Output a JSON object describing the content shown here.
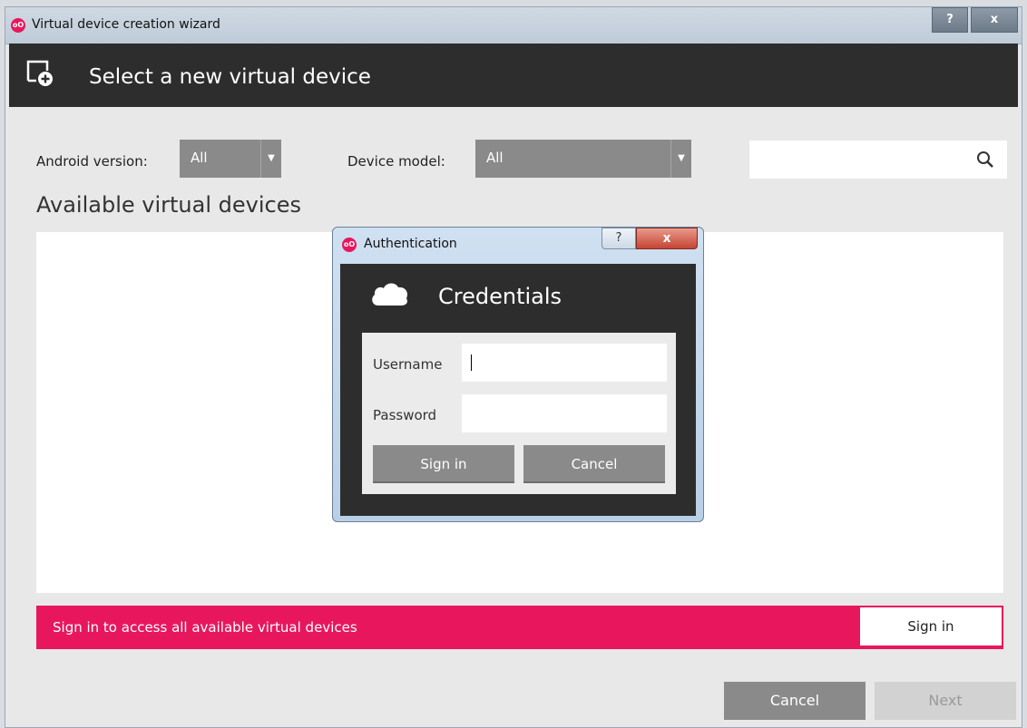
{
  "window": {
    "title": "Virtual device creation wizard",
    "logo_text": "oO",
    "help_label": "?",
    "close_label": "x"
  },
  "header": {
    "title": "Select a new virtual device"
  },
  "filters": {
    "android_label": "Android version:",
    "android_value": "All",
    "device_label": "Device model:",
    "device_value": "All",
    "search_value": ""
  },
  "main": {
    "section_title": "Available virtual devices"
  },
  "banner": {
    "text": "Sign in to access all available virtual devices",
    "button": "Sign in",
    "color": "#e8175d"
  },
  "footer": {
    "cancel": "Cancel",
    "next": "Next"
  },
  "dialog": {
    "title": "Authentication",
    "logo_text": "oO",
    "help_label": "?",
    "close_label": "x",
    "heading": "Credentials",
    "username_label": "Username",
    "username_value": "",
    "password_label": "Password",
    "password_value": "",
    "signin": "Sign in",
    "cancel": "Cancel"
  }
}
